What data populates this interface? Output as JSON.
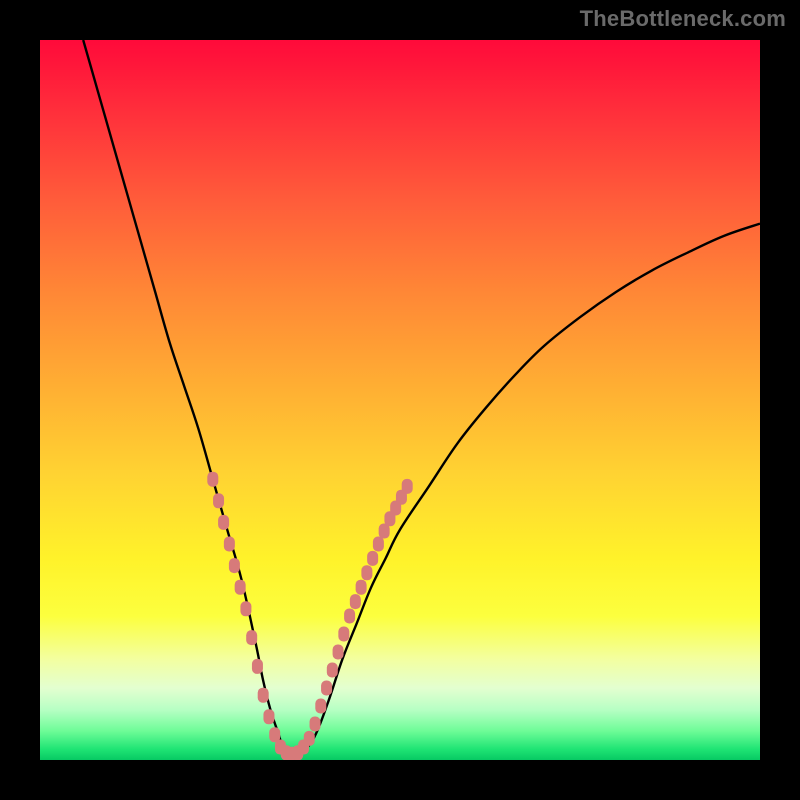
{
  "watermark": "TheBottleneck.com",
  "colors": {
    "background": "#000000",
    "curve": "#000000",
    "marker_fill": "#d77a7a",
    "gradient_top": "#ff0a3a",
    "gradient_bottom": "#07c963"
  },
  "chart_data": {
    "type": "line",
    "title": "",
    "xlabel": "",
    "ylabel": "",
    "xlim": [
      0,
      100
    ],
    "ylim": [
      0,
      100
    ],
    "grid": false,
    "series": [
      {
        "name": "bottleneck-curve",
        "x": [
          6,
          8,
          10,
          12,
          14,
          16,
          18,
          20,
          22,
          24,
          26,
          28,
          30,
          31,
          32,
          33,
          34,
          36,
          38,
          40,
          42,
          44,
          46,
          48,
          50,
          54,
          58,
          62,
          66,
          70,
          75,
          80,
          85,
          90,
          95,
          100
        ],
        "y": [
          100,
          93,
          86,
          79,
          72,
          65,
          58,
          52,
          46,
          39,
          32,
          25,
          16,
          11,
          7,
          4,
          1.5,
          1,
          3,
          8,
          14,
          19,
          24,
          28,
          32,
          38,
          44,
          49,
          53.5,
          57.5,
          61.5,
          65,
          68,
          70.5,
          72.8,
          74.5
        ]
      }
    ],
    "markers": {
      "name": "highlight-dots",
      "color": "#d77a7a",
      "points": [
        {
          "x": 24.0,
          "y": 39
        },
        {
          "x": 24.8,
          "y": 36
        },
        {
          "x": 25.5,
          "y": 33
        },
        {
          "x": 26.3,
          "y": 30
        },
        {
          "x": 27.0,
          "y": 27
        },
        {
          "x": 27.8,
          "y": 24
        },
        {
          "x": 28.6,
          "y": 21
        },
        {
          "x": 29.4,
          "y": 17
        },
        {
          "x": 30.2,
          "y": 13
        },
        {
          "x": 31.0,
          "y": 9
        },
        {
          "x": 31.8,
          "y": 6
        },
        {
          "x": 32.6,
          "y": 3.5
        },
        {
          "x": 33.4,
          "y": 1.8
        },
        {
          "x": 34.2,
          "y": 1.0
        },
        {
          "x": 35.0,
          "y": 0.8
        },
        {
          "x": 35.8,
          "y": 1.0
        },
        {
          "x": 36.6,
          "y": 1.8
        },
        {
          "x": 37.4,
          "y": 3.0
        },
        {
          "x": 38.2,
          "y": 5.0
        },
        {
          "x": 39.0,
          "y": 7.5
        },
        {
          "x": 39.8,
          "y": 10.0
        },
        {
          "x": 40.6,
          "y": 12.5
        },
        {
          "x": 41.4,
          "y": 15.0
        },
        {
          "x": 42.2,
          "y": 17.5
        },
        {
          "x": 43.0,
          "y": 20.0
        },
        {
          "x": 43.8,
          "y": 22.0
        },
        {
          "x": 44.6,
          "y": 24.0
        },
        {
          "x": 45.4,
          "y": 26.0
        },
        {
          "x": 46.2,
          "y": 28.0
        },
        {
          "x": 47.0,
          "y": 30.0
        },
        {
          "x": 47.8,
          "y": 31.8
        },
        {
          "x": 48.6,
          "y": 33.5
        },
        {
          "x": 49.4,
          "y": 35.0
        },
        {
          "x": 50.2,
          "y": 36.5
        },
        {
          "x": 51.0,
          "y": 38.0
        }
      ]
    }
  }
}
